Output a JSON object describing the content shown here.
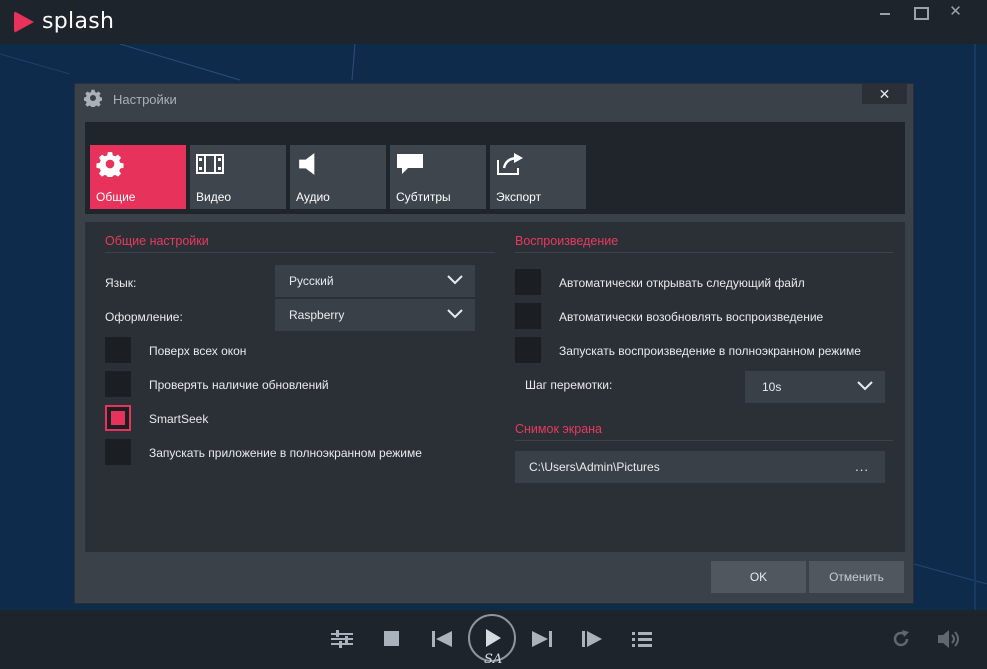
{
  "app": {
    "name": "splash"
  },
  "dialog": {
    "title": "Настройки",
    "close_glyph": "✕",
    "tabs": [
      {
        "label": "Общие",
        "icon": "gear-icon",
        "active": true
      },
      {
        "label": "Видео",
        "icon": "film-icon",
        "active": false
      },
      {
        "label": "Аудио",
        "icon": "speaker-icon",
        "active": false
      },
      {
        "label": "Субтитры",
        "icon": "speech-bubble-icon",
        "active": false
      },
      {
        "label": "Экспорт",
        "icon": "export-icon",
        "active": false
      }
    ],
    "general": {
      "title": "Общие настройки",
      "language_label": "Язык:",
      "language_value": "Русский",
      "theme_label": "Оформление:",
      "theme_value": "Raspberry",
      "checkboxes": [
        {
          "label": "Поверх всех окон",
          "checked": false
        },
        {
          "label": "Проверять наличие обновлений",
          "checked": false
        },
        {
          "label": "SmartSeek",
          "checked": true
        },
        {
          "label": "Запускать приложение в полноэкранном режиме",
          "checked": false
        }
      ]
    },
    "playback": {
      "title": "Воспроизведение",
      "checkboxes": [
        {
          "label": "Автоматически открывать следующий файл",
          "checked": false
        },
        {
          "label": "Автоматически возобновлять воспроизведение",
          "checked": false
        },
        {
          "label": "Запускать воспроизведение в полноэкранном режиме",
          "checked": false
        }
      ],
      "seek_label": "Шаг перемотки:",
      "seek_value": "10s"
    },
    "screenshot": {
      "title": "Снимок экрана",
      "path": "C:\\Users\\Admin\\Pictures",
      "browse": "..."
    },
    "buttons": {
      "ok": "OK",
      "cancel": "Отменить"
    }
  },
  "player": {
    "play_caption": "SA"
  },
  "colors": {
    "accent": "#e7325b",
    "panel": "#2b3036",
    "dialog": "#3b4149",
    "backdrop": "#0e2b4c"
  }
}
